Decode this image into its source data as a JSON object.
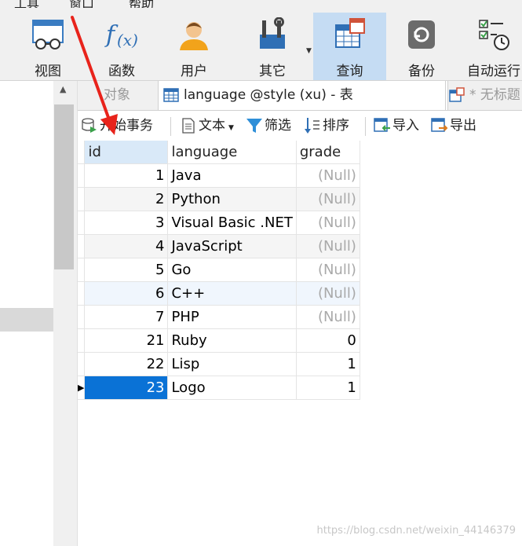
{
  "menubar": [
    "工具",
    "窗口",
    "帮助"
  ],
  "toolbar": {
    "buttons": [
      {
        "label": "视图",
        "icon": "view-icon"
      },
      {
        "label": "函数",
        "icon": "function-icon"
      },
      {
        "label": "用户",
        "icon": "user-icon"
      },
      {
        "label": "其它",
        "icon": "tools-icon"
      },
      {
        "label": "查询",
        "icon": "query-icon",
        "active": true
      },
      {
        "label": "备份",
        "icon": "backup-icon"
      },
      {
        "label": "自动运行",
        "icon": "automation-icon"
      }
    ]
  },
  "tabs": {
    "objects": "对象",
    "active": "language @style (xu) - 表",
    "untitled": "* 无标题"
  },
  "actions": {
    "begin_transaction": "开始事务",
    "text": "文本",
    "filter": "筛选",
    "sort": "排序",
    "import": "导入",
    "export": "导出"
  },
  "table": {
    "columns": [
      "id",
      "language",
      "grade"
    ],
    "rows": [
      {
        "id": "1",
        "language": "Java",
        "grade": "(Null)"
      },
      {
        "id": "2",
        "language": "Python",
        "grade": "(Null)"
      },
      {
        "id": "3",
        "language": "Visual Basic .NET",
        "grade": "(Null)"
      },
      {
        "id": "4",
        "language": "JavaScript",
        "grade": "(Null)"
      },
      {
        "id": "5",
        "language": "Go",
        "grade": "(Null)"
      },
      {
        "id": "6",
        "language": "C++",
        "grade": "(Null)"
      },
      {
        "id": "7",
        "language": "PHP",
        "grade": "(Null)"
      },
      {
        "id": "21",
        "language": "Ruby",
        "grade": "0"
      },
      {
        "id": "22",
        "language": "Lisp",
        "grade": "1"
      },
      {
        "id": "23",
        "language": "Logo",
        "grade": "1"
      }
    ],
    "selected_row_index": 9
  },
  "watermark": "https://blog.csdn.net/weixin_44146379",
  "colors": {
    "accent": "#0a72d6",
    "active_tab": "#c5dcf3",
    "annotation_arrow": "#e8231b"
  }
}
